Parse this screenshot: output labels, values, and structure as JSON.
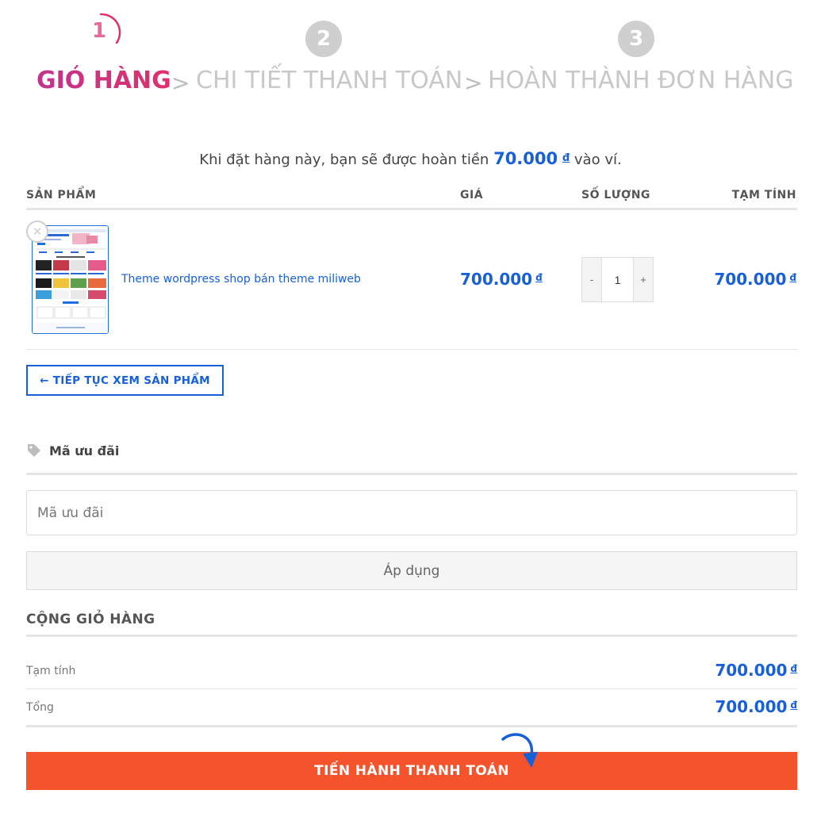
{
  "steps": [
    {
      "number": "1",
      "label": "GIỎ HÀNG",
      "active": true
    },
    {
      "number": "2",
      "label": "CHI TIẾT THANH TOÁN",
      "active": false
    },
    {
      "number": "3",
      "label": "HOÀN THÀNH ĐƠN HÀNG",
      "active": false
    }
  ],
  "step_separator": ">",
  "cashback": {
    "prefix": "Khi đặt hàng này, bạn sẽ được hoàn tiền",
    "amount": "70.000",
    "currency": "đ",
    "suffix": "vào ví."
  },
  "cart_table": {
    "headers": {
      "product": "SẢN PHẨM",
      "price": "GIÁ",
      "quantity": "SỐ LƯỢNG",
      "subtotal": "TẠM TÍNH"
    },
    "items": [
      {
        "name": "Theme wordpress shop bán theme miliweb",
        "price": "700.000",
        "currency": "đ",
        "quantity": "1",
        "subtotal": "700.000"
      }
    ],
    "qty_minus": "-",
    "qty_plus": "+"
  },
  "continue_button": "← TIẾP TỤC XEM SẢN PHẨM",
  "coupon": {
    "title": "Mã ưu đãi",
    "placeholder": "Mã ưu đãi",
    "apply_label": "Áp dụng"
  },
  "totals": {
    "title": "CỘNG GIỎ HÀNG",
    "subtotal_label": "Tạm tính",
    "subtotal_value": "700.000",
    "total_label": "Tổng",
    "total_value": "700.000",
    "currency": "đ"
  },
  "checkout_button": "TIẾN HÀNH THANH TOÁN",
  "colors": {
    "accent_blue": "#1760d8",
    "active_step": "#d0317a",
    "checkout": "#f4532c",
    "inactive_step": "#c8c8c8"
  }
}
